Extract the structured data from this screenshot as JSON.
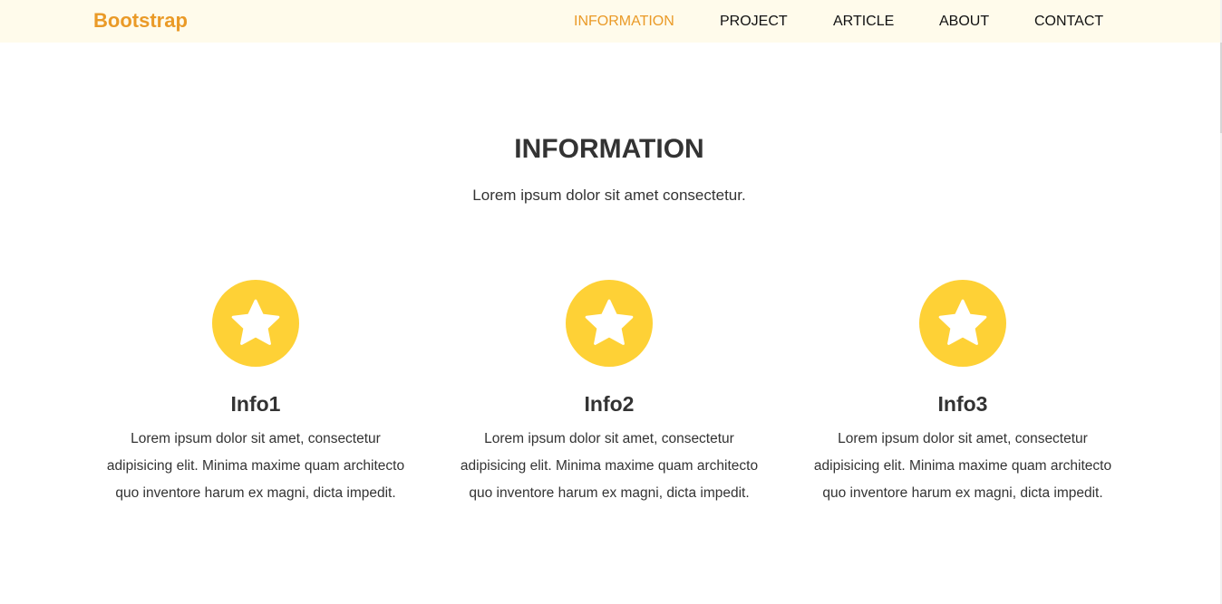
{
  "navbar": {
    "brand": "Bootstrap",
    "links": [
      {
        "label": "INFORMATION",
        "active": true
      },
      {
        "label": "PROJECT",
        "active": false
      },
      {
        "label": "ARTICLE",
        "active": false
      },
      {
        "label": "ABOUT",
        "active": false
      },
      {
        "label": "CONTACT",
        "active": false
      }
    ]
  },
  "section": {
    "title": "INFORMATION",
    "subtitle": "Lorem ipsum dolor sit amet consectetur."
  },
  "cards": [
    {
      "icon": "star-icon",
      "title": "Info1",
      "text": "Lorem ipsum dolor sit amet, consectetur adipisicing elit. Minima maxime quam architecto quo inventore harum ex magni, dicta impedit."
    },
    {
      "icon": "star-icon",
      "title": "Info2",
      "text": "Lorem ipsum dolor sit amet, consectetur adipisicing elit. Minima maxime quam architecto quo inventore harum ex magni, dicta impedit."
    },
    {
      "icon": "star-icon",
      "title": "Info3",
      "text": "Lorem ipsum dolor sit amet, consectetur adipisicing elit. Minima maxime quam architecto quo inventore harum ex magni, dicta impedit."
    }
  ],
  "colors": {
    "brand": "#ea9a27",
    "navbar_bg": "#fffbeb",
    "icon_bg": "#fed136",
    "text": "#333333"
  }
}
